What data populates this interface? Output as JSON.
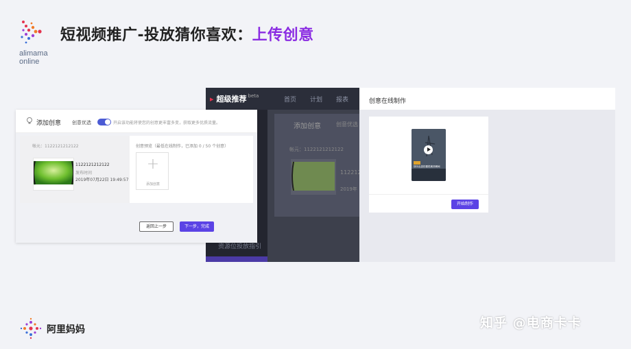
{
  "header": {
    "brand_name_line1": "alimama",
    "brand_name_line2": "online",
    "title_prefix": "短视频推广-投放猜你喜欢：",
    "title_highlight": "上传创意"
  },
  "app": {
    "brand": "超级推荐",
    "beta": "beta",
    "nav": [
      "首页",
      "计划",
      "报表"
    ],
    "dim_footer_text": "资源位投放指引",
    "dim_acct": "帐元：1122121212122",
    "dim_num": "112212",
    "dim_num2": "2019年"
  },
  "left_window": {
    "title": "添加创意",
    "optimize_label": "创意优选",
    "optimize_hint": "开启该功能将使您的创意更丰富多变，获取更多优质流量。",
    "account": "帐元：1122121212122",
    "creative_id": "1122121212122",
    "publish_label": "发布时间",
    "publish_time": "2019年07月22日 19:49:57",
    "preview_label": "创意预览（最低在线制作，已添加 0 / 50 个创意）",
    "add_label": "添加创意",
    "back_button": "返回上一步",
    "next_button": "下一步，完成"
  },
  "right_panel": {
    "title": "创意在线制作",
    "phone_caption": "快乐出游的喜悦美好瞬间",
    "start_button": "开始制作"
  },
  "footer": {
    "brand": "阿里妈妈",
    "watermark": "知乎 @电商卡卡"
  },
  "colors": {
    "primary_button": "#5b43e5",
    "title_highlight": "#8a2be2",
    "dark_bg": "#23252f"
  }
}
